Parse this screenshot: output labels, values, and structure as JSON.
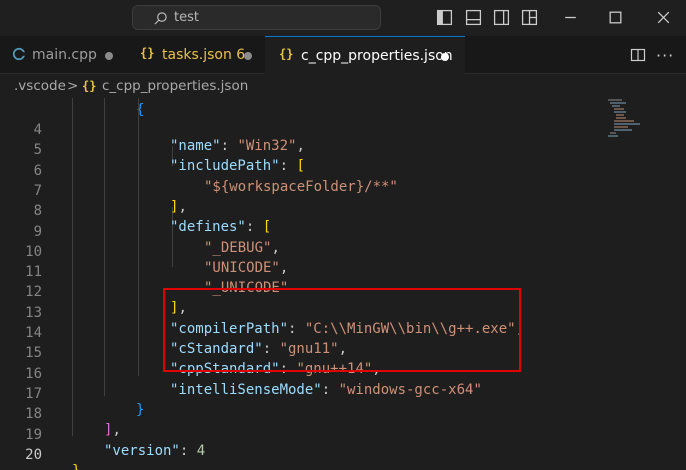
{
  "titlebar": {
    "search_text": "test",
    "icons": [
      "search-icon",
      "toggle-primary-sidebar-icon",
      "toggle-panel-icon",
      "toggle-secondary-sidebar-icon",
      "customize-layout-icon"
    ],
    "window_controls": [
      "minimize-icon",
      "maximize-icon",
      "close-icon"
    ]
  },
  "tabs": [
    {
      "label": "main.cpp",
      "icon": "cpp-file-icon",
      "modified": true,
      "active": false
    },
    {
      "label": "tasks.json 6",
      "icon": "json-file-icon",
      "modified": true,
      "active": false
    },
    {
      "label": "c_cpp_properties.json",
      "icon": "json-file-icon",
      "modified": true,
      "active": true
    }
  ],
  "tab_actions": {
    "more_label": "···"
  },
  "breadcrumb": {
    "folder": ".vscode",
    "separator": ">",
    "file_icon": "{}",
    "file": "c_cpp_properties.json"
  },
  "editor": {
    "current_line": "20",
    "lines": [
      {
        "num": "4"
      },
      {
        "num": "5"
      },
      {
        "num": "6"
      },
      {
        "num": "7"
      },
      {
        "num": "8"
      },
      {
        "num": "9"
      },
      {
        "num": "10"
      },
      {
        "num": "11"
      },
      {
        "num": "12"
      },
      {
        "num": "13"
      },
      {
        "num": "14"
      },
      {
        "num": "15"
      },
      {
        "num": "16"
      },
      {
        "num": "17"
      },
      {
        "num": "18"
      },
      {
        "num": "19"
      },
      {
        "num": "20"
      }
    ],
    "tokens": {
      "name_key": "\"name\"",
      "name_val": "\"Win32\"",
      "includePath_key": "\"includePath\"",
      "includePath_val": "\"${workspaceFolder}/**\"",
      "defines_key": "\"defines\"",
      "def1": "\"_DEBUG\"",
      "def2": "\"UNICODE\"",
      "def3": "\"_UNICODE\"",
      "compilerPath_key": "\"compilerPath\"",
      "compilerPath_val": "\"C:\\\\MinGW\\\\bin\\\\g++.exe\"",
      "cStandard_key": "\"cStandard\"",
      "cStandard_val": "\"gnu11\"",
      "cppStandard_key": "\"cppStandard\"",
      "cppStandard_val": "\"gnu++14\"",
      "intelliSenseMode_key": "\"intelliSenseMode\"",
      "intelliSenseMode_val": "\"windows-gcc-x64\"",
      "version_key": "\"version\"",
      "version_val": "4"
    }
  },
  "colors": {
    "accent": "#0078d4",
    "highlight_border": "#e00000",
    "json_key": "#9cdcfe",
    "json_string": "#ce9178",
    "json_number": "#b5cea8"
  }
}
